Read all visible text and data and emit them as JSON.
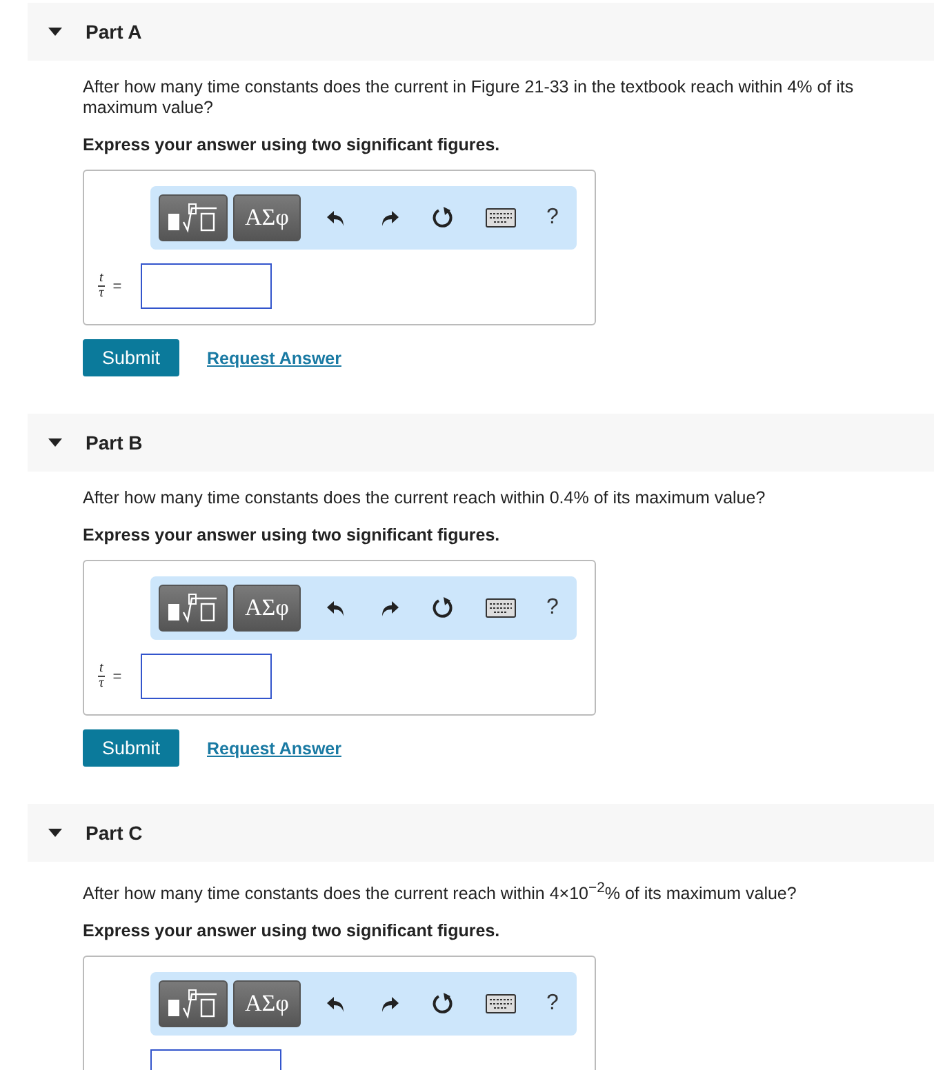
{
  "parts": [
    {
      "title": "Part A",
      "expanded": true,
      "question": "After how many time constants does the current in Figure 21-33 in the textbook reach within 4% of its maximum value?",
      "instruction": "Express your answer using two significant figures.",
      "toolbar": {
        "symbols_button": "ΑΣφ",
        "help_button": "?"
      },
      "answer": {
        "numerator": "t",
        "denominator": "τ",
        "equals": "="
      },
      "submit": "Submit",
      "request_answer": "Request Answer"
    },
    {
      "title": "Part B",
      "expanded": true,
      "question": "After how many time constants does the current reach within 0.4% of its maximum value?",
      "instruction": "Express your answer using two significant figures.",
      "toolbar": {
        "symbols_button": "ΑΣφ",
        "help_button": "?"
      },
      "answer": {
        "numerator": "t",
        "denominator": "τ",
        "equals": "="
      },
      "submit": "Submit",
      "request_answer": "Request Answer"
    },
    {
      "title": "Part C",
      "expanded": true,
      "question": "After how many time constants does the current reach within 4×10$^{−2}$% of its maximum value?",
      "instruction": "Express your answer using two significant figures.",
      "toolbar": {
        "symbols_button": "ΑΣφ",
        "help_button": "?"
      }
    }
  ]
}
